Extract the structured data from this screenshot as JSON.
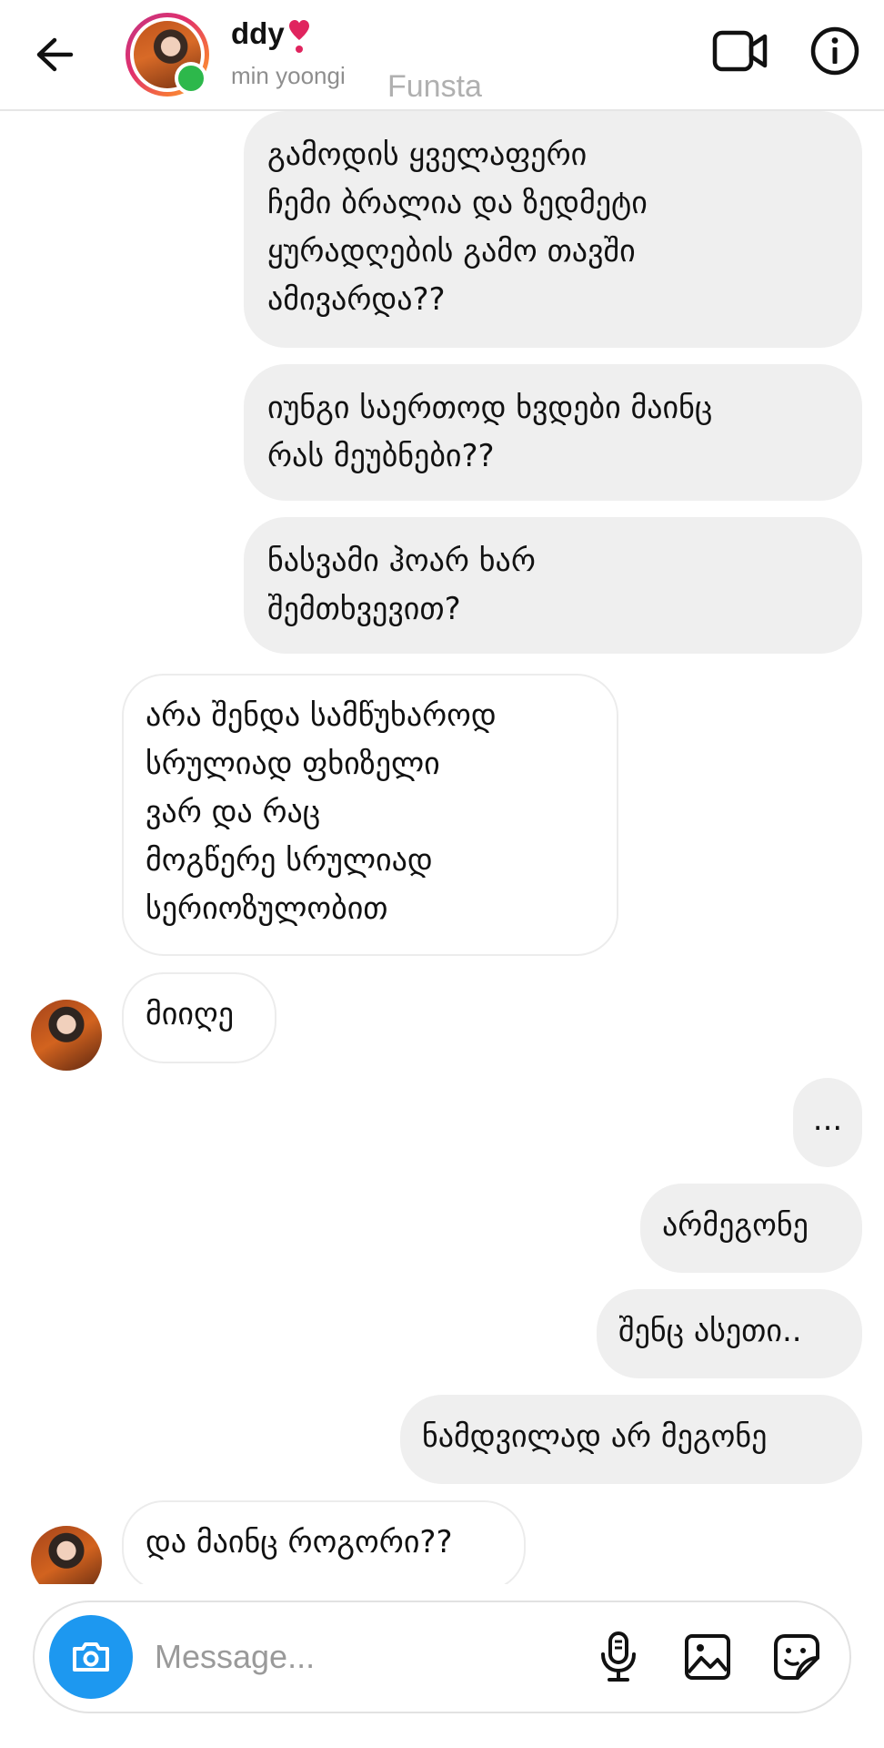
{
  "header": {
    "name": "ddy",
    "subtitle": "min yoongi",
    "tag": "Funsta"
  },
  "messages": [
    {
      "side": "sent",
      "text": "გამოდის ყველაფერი\nჩემი ბრალია და ზედმეტი\nყურადღების გამო თავში\nამივარდა??"
    },
    {
      "side": "sent",
      "text": "იუნგი საერთოდ ხვდები მაინც\nრას მეუბნები??"
    },
    {
      "side": "sent",
      "text": "ნასვამი ჰოარ ხარ\nშემთხვევით?"
    },
    {
      "side": "received",
      "text": "არა შენდა სამწუხაროდ\nსრულიად ფხიზელი\nვარ და რაც\nმოგწერე სრულიად\nსერიოზულობით"
    },
    {
      "side": "received",
      "text": "მიიღე"
    },
    {
      "side": "sent",
      "text": "..."
    },
    {
      "side": "sent",
      "text": "არმეგონე"
    },
    {
      "side": "sent",
      "text": "შენც ასეთი.."
    },
    {
      "side": "sent",
      "text": "ნამდვილად არ მეგონე"
    },
    {
      "side": "received",
      "text": "და მაინც როგორი??"
    }
  ],
  "composer": {
    "placeholder": "Message..."
  },
  "icons": {
    "back": "arrow-left-icon",
    "heart": "red-heart-exclamation-icon",
    "video": "video-camera-icon",
    "info": "info-icon",
    "camera": "camera-icon",
    "mic": "microphone-icon",
    "gallery": "image-icon",
    "sticker": "sticker-icon"
  },
  "colors": {
    "online": "#2db84b",
    "camera_button": "#1d98f0",
    "sent_bubble": "#efefef",
    "heart": "#e0245e"
  }
}
